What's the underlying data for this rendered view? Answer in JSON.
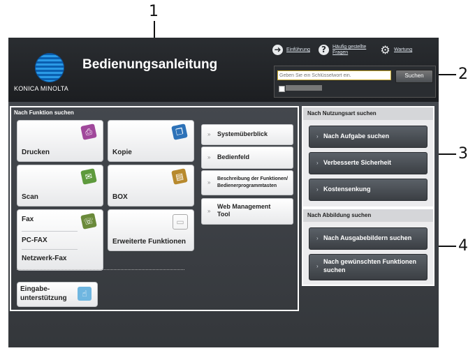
{
  "callouts": {
    "c1": "1",
    "c2": "2",
    "c3": "3",
    "c4": "4"
  },
  "header": {
    "title": "Bedienungsanleitung",
    "logo_text": "KONICA MINOLTA",
    "links": {
      "intro": "Einführung",
      "faq_line1": "Häufig gestellte",
      "faq_line2": "Fragen",
      "maintenance": "Wartung"
    },
    "link_icons": {
      "intro": "arrow-right-icon",
      "faq": "question-mark-icon",
      "maintenance": "gear-icon"
    }
  },
  "search": {
    "placeholder": "Geben Sie ein Schlüsselwort ein.",
    "button": "Suchen"
  },
  "function_panel": {
    "label": "Nach Funktion suchen",
    "tiles": {
      "print": "Drucken",
      "copy": "Kopie",
      "scan": "Scan",
      "box": "BOX",
      "fax": "Fax",
      "pcfax": "PC-FAX",
      "netfax": "Netzwerk-Fax",
      "extended": "Erweiterte Funktionen",
      "input_line1": "Eingabe-",
      "input_line2": "unterstützung"
    },
    "side": {
      "overview": "Systemüberblick",
      "panel": "Bedienfeld",
      "desc_line1": "Beschreibung der Funktionen/",
      "desc_line2": "Bedienerprogrammtasten",
      "web_line1": "Web Management",
      "web_line2": "Tool"
    }
  },
  "usage_panel": {
    "label": "Nach Nutzungsart suchen",
    "buttons": [
      "Nach Aufgabe suchen",
      "Verbesserte Sicherheit",
      "Kostensenkung"
    ]
  },
  "image_panel": {
    "label": "Nach Abbildung suchen",
    "buttons": {
      "output": "Nach Ausgabebildern suchen",
      "desired_line1": "Nach gewünschten Funktionen",
      "desired_line2": "suchen"
    }
  },
  "colors": {
    "accent_yellow": "#c8a92c",
    "logo_blue": "#0a5fb0"
  }
}
